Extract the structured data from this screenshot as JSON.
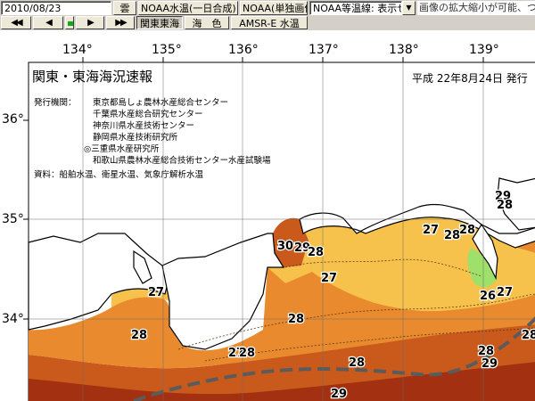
{
  "toolbar": {
    "date_value": "2010/08/23",
    "weather_button": "雲",
    "noaa_composite_button": "NOAA水温(一日合成)",
    "noaa_single_button": "NOAA(単独画像)",
    "isotherm_select_value": "NOAA等温線: 表示せず",
    "ticker_text": "画像の拡大縮小が可能、つかんで引きずると動かせます",
    "nav_first": "◀◀",
    "nav_prev": "◀",
    "nav_next": "▶",
    "nav_last": "▶▶",
    "kanto_tokai_tab": "関東東海",
    "ocean_color_tab": "海　色",
    "amsre_tab": "AMSR-E 水温"
  },
  "map": {
    "longitude_labels": [
      "134°",
      "135°",
      "136°",
      "137°",
      "138°",
      "139°"
    ],
    "latitude_labels": [
      "36°",
      "35°",
      "34°"
    ],
    "title": "関東・東海海況速報",
    "date": "平成 22年8月24日  発行",
    "issuer_label": "発行機関：",
    "issuers": [
      "東京都島しょ農林水産総合センター",
      "千葉県水産総合研究センター",
      "神奈川県水産技術センター",
      "静岡県水産技術研究所",
      "◎三重県水産研究所",
      "和歌山県農林水産総合技術センター水産試験場"
    ],
    "sources": "資料：船舶水温、衛星水温、気象庁解析水温",
    "isotherm_labels": [
      "29",
      "28",
      "27",
      "28",
      "27",
      "30",
      "29",
      "28",
      "27",
      "28",
      "26",
      "27",
      "27",
      "28",
      "28",
      "28",
      "28",
      "29",
      "29",
      "28",
      "28"
    ]
  },
  "colors": {
    "land": "#ffffff",
    "sea_26": "#9ee06a",
    "sea_27": "#f6c24c",
    "sea_28": "#e98a2e",
    "sea_29": "#c95a1c",
    "sea_30": "#a33010",
    "kuroshio_path": "#5b5b5b"
  }
}
